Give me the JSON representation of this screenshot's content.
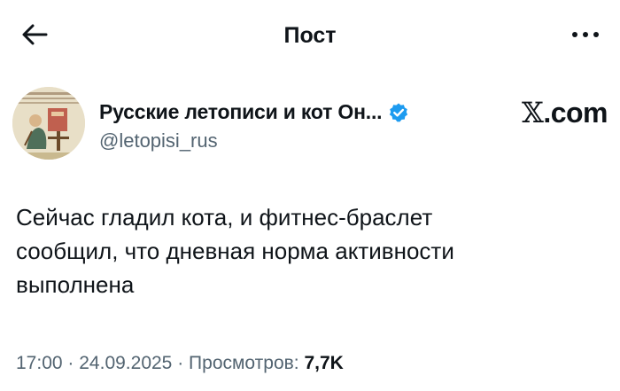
{
  "header": {
    "title": "Пост"
  },
  "author": {
    "name": "Русские летописи и кот Он...",
    "handle": "@letopisi_rus",
    "verified": true,
    "badge_color": "#1d9bf0"
  },
  "watermark": {
    "logo": "𝕏",
    "suffix": ".com"
  },
  "post": {
    "text_line_1": "Сейчас гладил кота, и фитнес-браслет",
    "text_line_2": "сообщил, что дневная норма активности",
    "text_line_3": "выполнена"
  },
  "meta": {
    "time": "17:00",
    "date": "24.09.2025",
    "views_label": "Просмотров:",
    "views_count": "7,7K",
    "separator": "·"
  },
  "icons": {
    "back": "arrow-left-icon",
    "more": "more-horizontal-icon",
    "verified": "verified-badge-icon"
  }
}
